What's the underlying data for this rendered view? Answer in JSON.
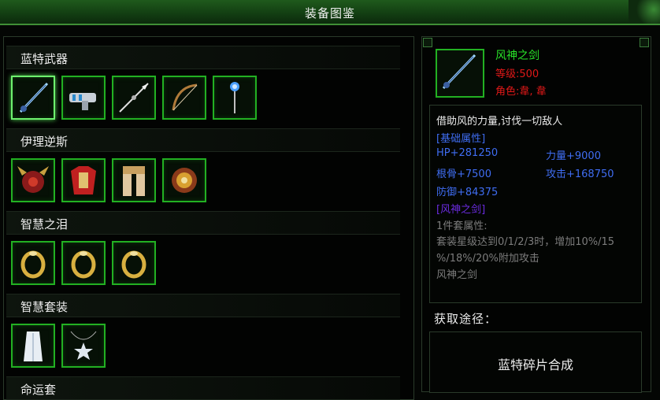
{
  "window": {
    "title": "装备图鉴"
  },
  "sections": [
    {
      "label": "蓝特武器",
      "items": [
        "wind-god-sword-icon",
        "blaster-gun-icon",
        "spear-icon",
        "bow-icon",
        "crystal-staff-icon"
      ]
    },
    {
      "label": "伊理逆斯",
      "items": [
        "horned-helmet-icon",
        "red-armor-icon",
        "leg-armor-icon",
        "sun-amulet-icon"
      ]
    },
    {
      "label": "智慧之泪",
      "items": [
        "gold-ring-icon",
        "gold-ring-icon",
        "gold-ring-icon"
      ]
    },
    {
      "label": "智慧套装",
      "items": [
        "white-robe-icon",
        "star-necklace-icon"
      ]
    },
    {
      "label": "命运套"
    }
  ],
  "detail": {
    "name": "风神之剑",
    "level": "等级:500",
    "role": "角色:韋, 韋",
    "description": "借助风的力量,讨伐一切敌人",
    "base_header": "[基础属性]",
    "stats": {
      "hp": "HP+281250",
      "strength": "力量+9000",
      "bone": "根骨+7500",
      "attack": "攻击+168750",
      "defense": "防御+84375"
    },
    "set_header": "[风神之剑]",
    "set_pieces": "1件套属性:",
    "set_effect_1": "套装星级达到0/1/2/3时，增加10%/15",
    "set_effect_2": "%/18%/20%附加攻击",
    "set_name": "风神之剑"
  },
  "acquisition": {
    "title": "获取途径：",
    "method": "蓝特碎片合成"
  },
  "colors": {
    "accent_green": "#22b022",
    "name_green": "#28e028",
    "red": "#e01818",
    "stat_blue": "#3f6df2",
    "set_purple": "#6b2be0"
  }
}
